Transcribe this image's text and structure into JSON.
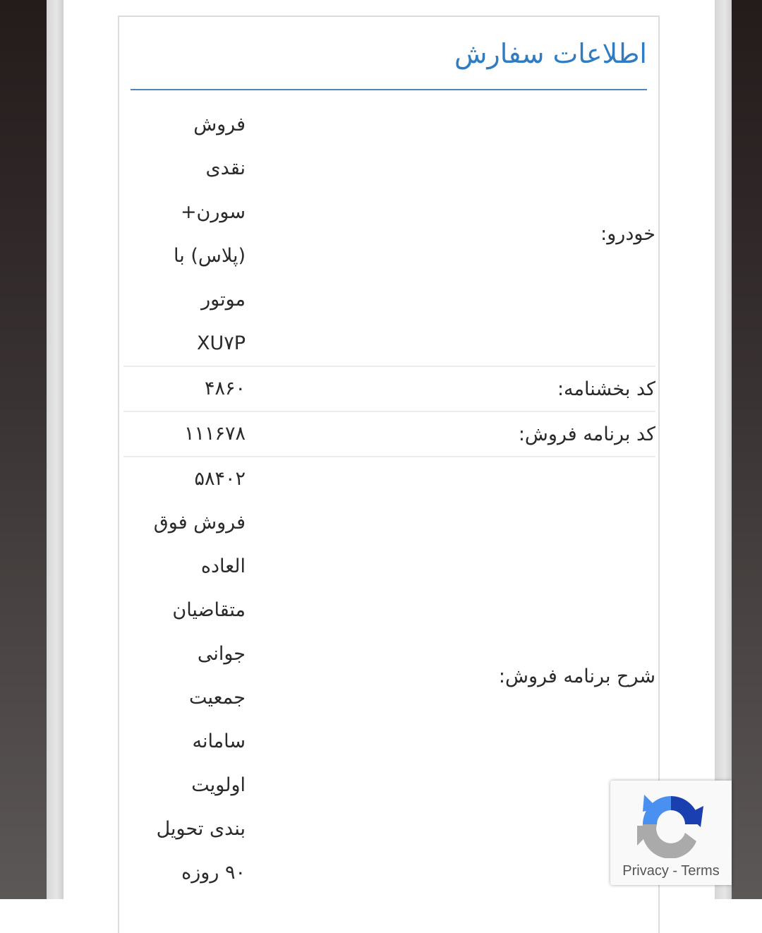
{
  "card": {
    "title": "اطلاعات سفارش"
  },
  "rows": [
    {
      "label": "خودرو:",
      "value_lines": [
        "فروش",
        "نقدی",
        "سورن+",
        "(پلاس) با",
        "موتور",
        "XU۷P"
      ]
    },
    {
      "label": "کد بخشنامه:",
      "value_lines": [
        "۴۸۶۰"
      ]
    },
    {
      "label": "کد برنامه فروش:",
      "value_lines": [
        "۱۱۱۶۷۸"
      ]
    },
    {
      "label": "شرح برنامه فروش:",
      "value_lines": [
        "۵۸۴۰۲",
        "فروش فوق",
        "العاده",
        "متقاضیان",
        "جوانی",
        "جمعیت",
        "سامانه",
        "اولویت",
        "بندی تحویل",
        "۹۰ روزه"
      ]
    }
  ],
  "recaptcha": {
    "icon": "recaptcha-logo-icon",
    "privacy_label": "Privacy",
    "separator": " - ",
    "terms_label": "Terms"
  },
  "colors": {
    "title": "#2f7cc3",
    "rule": "#4e87b8"
  }
}
